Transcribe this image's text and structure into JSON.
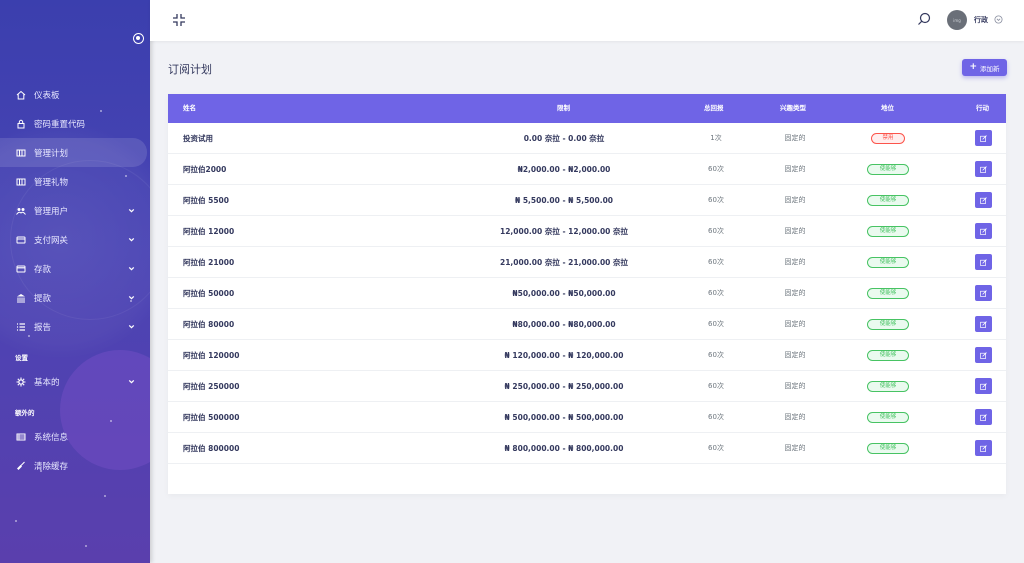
{
  "sidebar": {
    "items": [
      {
        "label": "仪表板",
        "icon": "home-icon",
        "has_children": false,
        "active": false
      },
      {
        "label": "密码重置代码",
        "icon": "lock-icon",
        "has_children": false,
        "active": false
      },
      {
        "label": "管理计划",
        "icon": "plan-icon",
        "has_children": false,
        "active": true
      },
      {
        "label": "管理礼物",
        "icon": "gift-icon",
        "has_children": false,
        "active": false
      },
      {
        "label": "管理用户",
        "icon": "users-icon",
        "has_children": true,
        "active": false
      },
      {
        "label": "支付网关",
        "icon": "credit-card-icon",
        "has_children": true,
        "active": false
      },
      {
        "label": "存款",
        "icon": "wallet-icon",
        "has_children": true,
        "active": false
      },
      {
        "label": "提款",
        "icon": "bank-icon",
        "has_children": true,
        "active": false
      },
      {
        "label": "报告",
        "icon": "list-icon",
        "has_children": true,
        "active": false
      }
    ],
    "settings_heading": "设置",
    "settings_items": [
      {
        "label": "基本的",
        "icon": "gear-icon",
        "has_children": true
      }
    ],
    "extra_heading": "额外的",
    "extra_items": [
      {
        "label": "系统信息",
        "icon": "server-icon",
        "has_children": false
      },
      {
        "label": "清除缓存",
        "icon": "broom-icon",
        "has_children": false
      }
    ]
  },
  "topbar": {
    "user_name": "行政",
    "avatar_text": "img"
  },
  "page": {
    "title": "订阅计划",
    "add_button_label": "添加新"
  },
  "table": {
    "headers": [
      "姓名",
      "限制",
      "总回报",
      "兴趣类型",
      "地位",
      "行动"
    ],
    "rows": [
      {
        "name": "投资试用",
        "limit": "0.00 奈拉 - 0.00 奈拉",
        "count": "1次",
        "type": "固定的",
        "status": "禁用",
        "status_kind": "off"
      },
      {
        "name": "阿拉伯2000",
        "limit": "₦2,000.00 - ₦2,000.00",
        "count": "60次",
        "type": "固定的",
        "status": "使能够",
        "status_kind": "on"
      },
      {
        "name": "阿拉伯 5500",
        "limit": "₦ 5,500.00 - ₦ 5,500.00",
        "count": "60次",
        "type": "固定的",
        "status": "使能够",
        "status_kind": "on"
      },
      {
        "name": "阿拉伯 12000",
        "limit": "12,000.00 奈拉 - 12,000.00 奈拉",
        "count": "60次",
        "type": "固定的",
        "status": "使能够",
        "status_kind": "on"
      },
      {
        "name": "阿拉伯 21000",
        "limit": "21,000.00 奈拉 - 21,000.00 奈拉",
        "count": "60次",
        "type": "固定的",
        "status": "使能够",
        "status_kind": "on"
      },
      {
        "name": "阿拉伯 50000",
        "limit": "₦50,000.00 - ₦50,000.00",
        "count": "60次",
        "type": "固定的",
        "status": "使能够",
        "status_kind": "on"
      },
      {
        "name": "阿拉伯 80000",
        "limit": "₦80,000.00 - ₦80,000.00",
        "count": "60次",
        "type": "固定的",
        "status": "使能够",
        "status_kind": "on"
      },
      {
        "name": "阿拉伯 120000",
        "limit": "₦ 120,000.00 - ₦ 120,000.00",
        "count": "60次",
        "type": "固定的",
        "status": "使能够",
        "status_kind": "on"
      },
      {
        "name": "阿拉伯 250000",
        "limit": "₦ 250,000.00 - ₦ 250,000.00",
        "count": "60次",
        "type": "固定的",
        "status": "使能够",
        "status_kind": "on"
      },
      {
        "name": "阿拉伯 500000",
        "limit": "₦ 500,000.00 - ₦ 500,000.00",
        "count": "60次",
        "type": "固定的",
        "status": "使能够",
        "status_kind": "on"
      },
      {
        "name": "阿拉伯 800000",
        "limit": "₦ 800,000.00 - ₦ 800,000.00",
        "count": "60次",
        "type": "固定的",
        "status": "使能够",
        "status_kind": "on"
      }
    ]
  },
  "colors": {
    "primary": "#6f64e6",
    "success": "#47c363",
    "danger": "#fc544b",
    "sidebar_top": "#3b3fae",
    "sidebar_bottom": "#5a3fad"
  }
}
